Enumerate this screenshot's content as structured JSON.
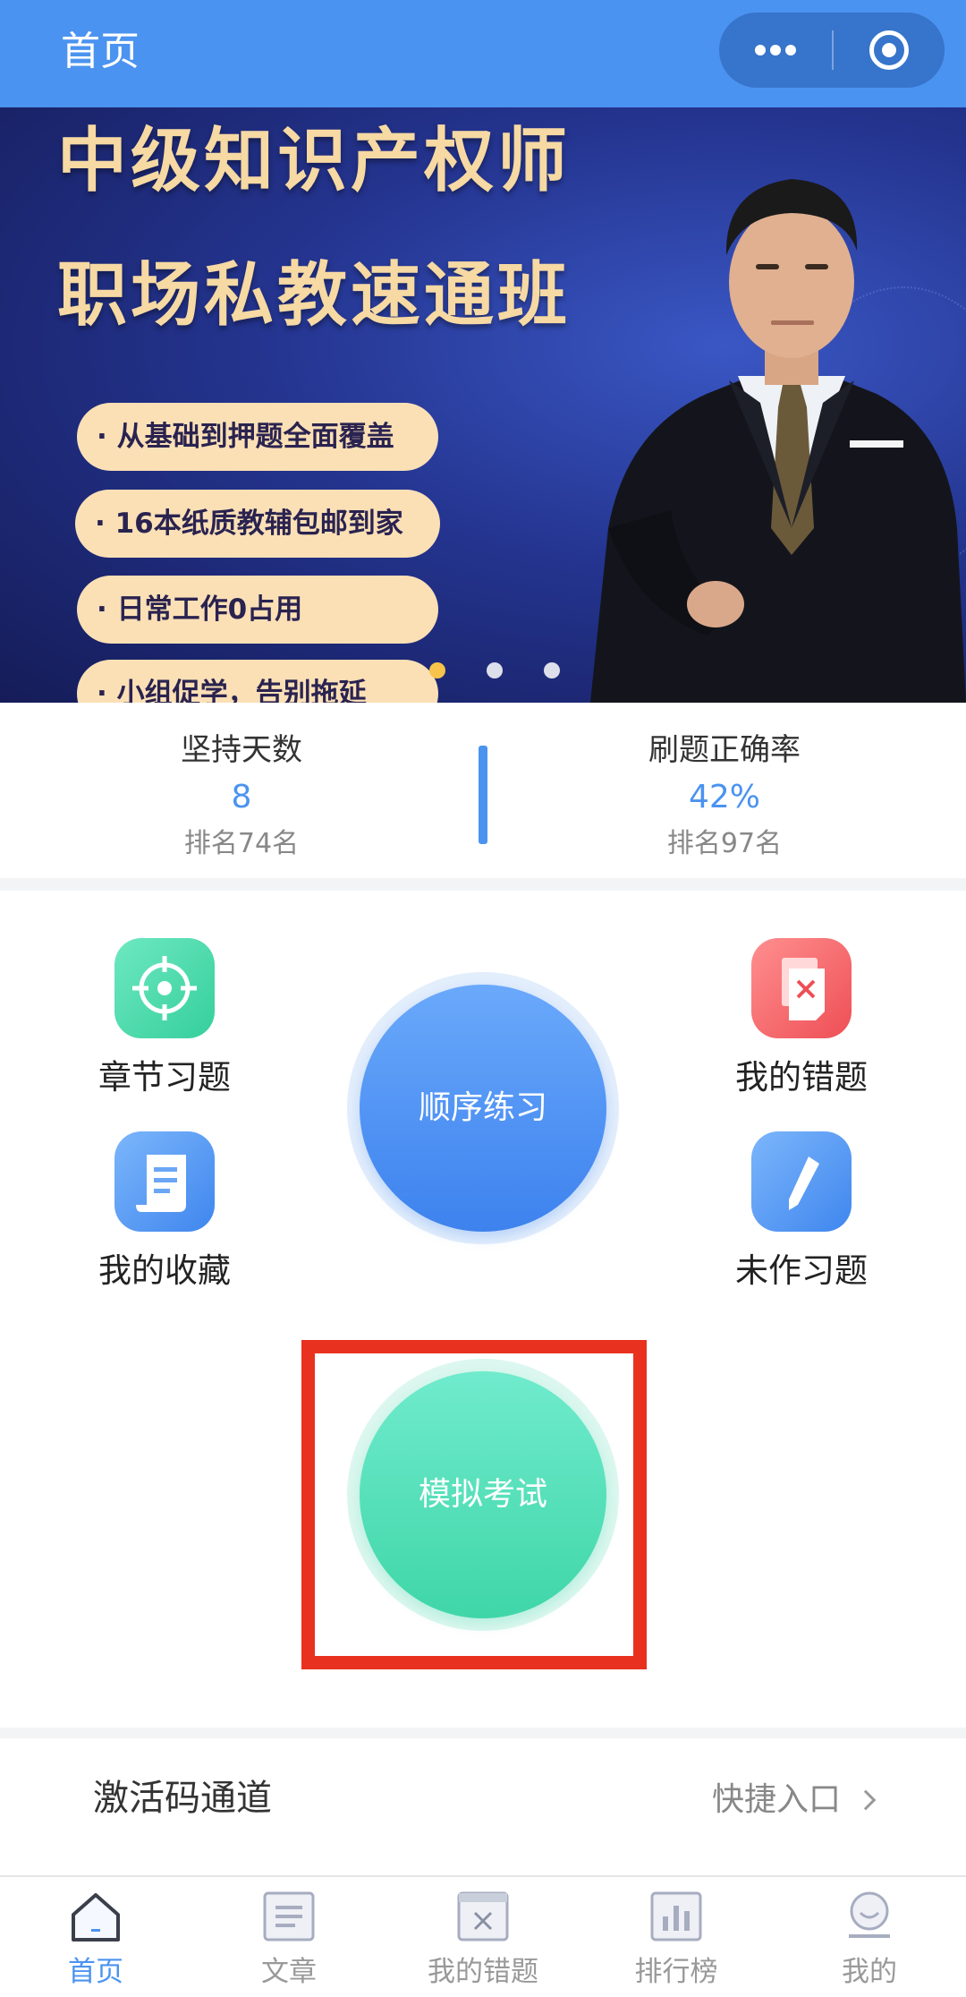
{
  "header": {
    "title": "首页"
  },
  "banner": {
    "title_line1": "中级知识产权师",
    "title_line2": "职场私教速通班",
    "bullets": [
      "· 从基础到押题全面覆盖",
      "· 16本纸质教辅包邮到家",
      "· 日常工作0占用",
      "· 小组促学，告别拖延"
    ],
    "carousel_active_color": "#f7c34a"
  },
  "stats": {
    "left": {
      "label": "坚持天数",
      "value": "8",
      "rank": "排名74名"
    },
    "right": {
      "label": "刷题正确率",
      "value": "42%",
      "rank": "排名97名"
    }
  },
  "functions": {
    "chapter": {
      "label": "章节习题",
      "icon": "crosshair-icon"
    },
    "favorites": {
      "label": "我的收藏",
      "icon": "document-icon"
    },
    "wrong": {
      "label": "我的错题",
      "icon": "wrong-doc-icon"
    },
    "undone": {
      "label": "未作习题",
      "icon": "pencil-icon"
    },
    "sequential": {
      "label": "顺序练习"
    },
    "mock_exam": {
      "label": "模拟考试"
    }
  },
  "activation": {
    "title": "激活码通道",
    "link": "快捷入口"
  },
  "tabbar": {
    "items": [
      {
        "label": "首页",
        "icon": "home-icon",
        "active": true
      },
      {
        "label": "文章",
        "icon": "article-icon",
        "active": false
      },
      {
        "label": "我的错题",
        "icon": "wrong-questions-icon",
        "active": false
      },
      {
        "label": "排行榜",
        "icon": "ranking-icon",
        "active": false
      },
      {
        "label": "我的",
        "icon": "profile-icon",
        "active": false
      }
    ]
  },
  "colors": {
    "primary": "#4b93f0",
    "mint": "#3fd6a8",
    "highlight": "#e8321f"
  }
}
